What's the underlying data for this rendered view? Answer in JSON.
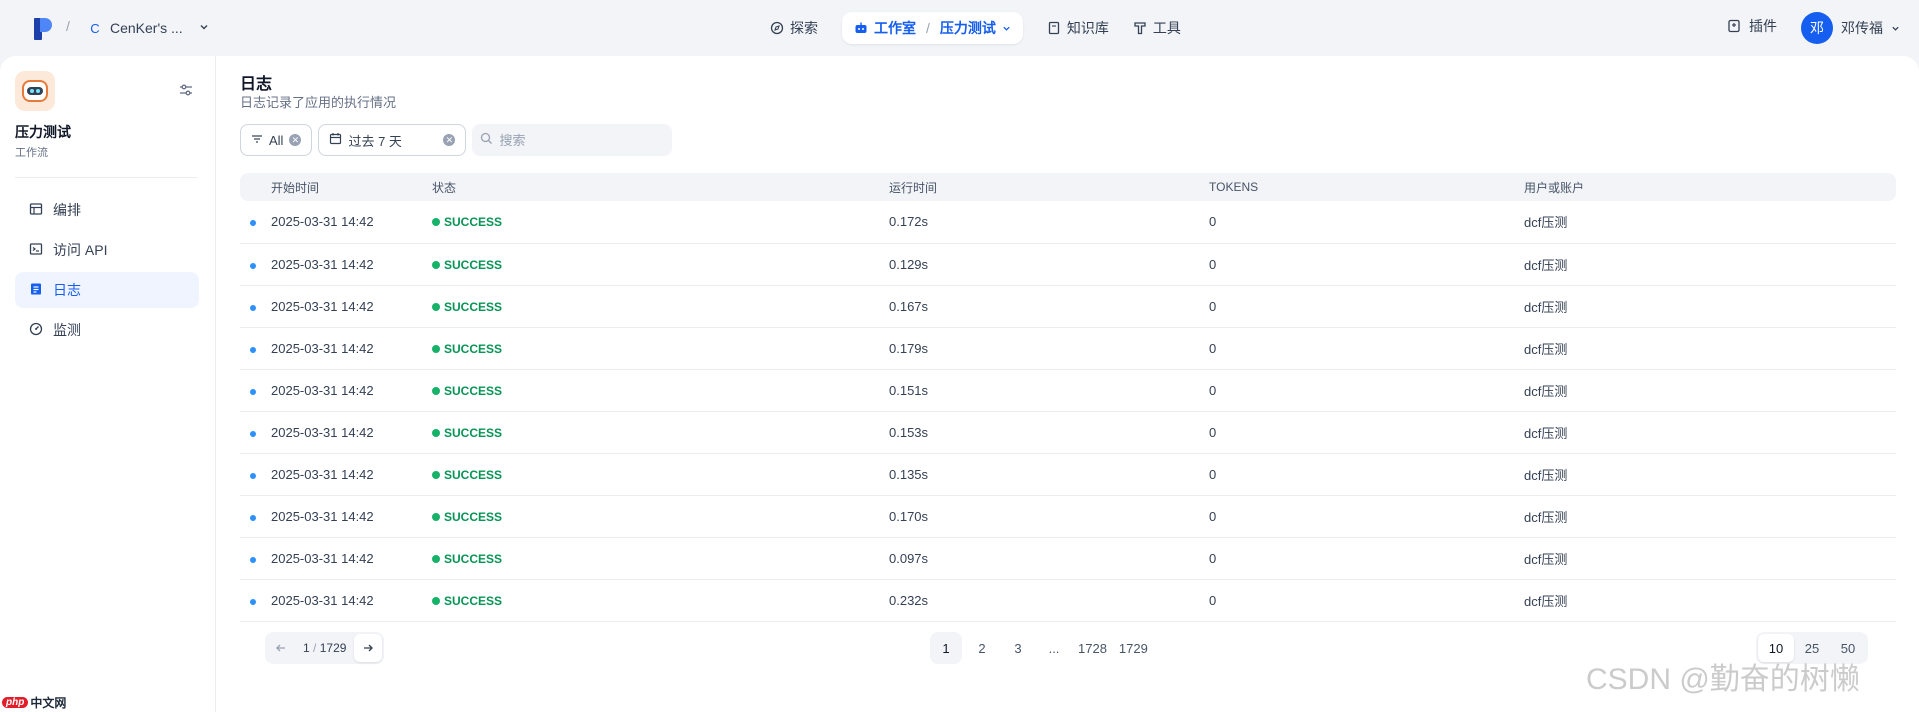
{
  "topbar": {
    "workspace_letter": "C",
    "workspace_name": "CenKer's ...",
    "nav": {
      "explore": "探索",
      "studio": "工作室",
      "studio_sub": "压力测试",
      "knowledge": "知识库",
      "tools": "工具"
    },
    "plugins": "插件",
    "user_initial": "邓",
    "user_name": "邓传福"
  },
  "sidebar": {
    "app_name": "压力测试",
    "app_type": "工作流",
    "items": [
      {
        "label": "编排",
        "icon": "layout-icon"
      },
      {
        "label": "访问 API",
        "icon": "terminal-icon"
      },
      {
        "label": "日志",
        "icon": "file-text-icon",
        "active": true
      },
      {
        "label": "监测",
        "icon": "gauge-icon"
      }
    ]
  },
  "logs": {
    "title": "日志",
    "description": "日志记录了应用的执行情况",
    "filter_status": "All",
    "filter_period": "过去 7 天",
    "search_placeholder": "搜索",
    "columns": [
      "开始时间",
      "状态",
      "运行时间",
      "TOKENS",
      "用户或账户"
    ],
    "rows": [
      {
        "start": "2025-03-31 14:42",
        "status": "SUCCESS",
        "runtime": "0.172s",
        "tokens": "0",
        "user": "dcf压测"
      },
      {
        "start": "2025-03-31 14:42",
        "status": "SUCCESS",
        "runtime": "0.129s",
        "tokens": "0",
        "user": "dcf压测"
      },
      {
        "start": "2025-03-31 14:42",
        "status": "SUCCESS",
        "runtime": "0.167s",
        "tokens": "0",
        "user": "dcf压测"
      },
      {
        "start": "2025-03-31 14:42",
        "status": "SUCCESS",
        "runtime": "0.179s",
        "tokens": "0",
        "user": "dcf压测"
      },
      {
        "start": "2025-03-31 14:42",
        "status": "SUCCESS",
        "runtime": "0.151s",
        "tokens": "0",
        "user": "dcf压测"
      },
      {
        "start": "2025-03-31 14:42",
        "status": "SUCCESS",
        "runtime": "0.153s",
        "tokens": "0",
        "user": "dcf压测"
      },
      {
        "start": "2025-03-31 14:42",
        "status": "SUCCESS",
        "runtime": "0.135s",
        "tokens": "0",
        "user": "dcf压测"
      },
      {
        "start": "2025-03-31 14:42",
        "status": "SUCCESS",
        "runtime": "0.170s",
        "tokens": "0",
        "user": "dcf压测"
      },
      {
        "start": "2025-03-31 14:42",
        "status": "SUCCESS",
        "runtime": "0.097s",
        "tokens": "0",
        "user": "dcf压测"
      },
      {
        "start": "2025-03-31 14:42",
        "status": "SUCCESS",
        "runtime": "0.232s",
        "tokens": "0",
        "user": "dcf压测"
      }
    ]
  },
  "pagination": {
    "current": "1",
    "slash": "/",
    "total": "1729",
    "pages": [
      "1",
      "2",
      "3",
      "...",
      "1728",
      "1729"
    ],
    "page_sizes": [
      "10",
      "25",
      "50"
    ]
  },
  "watermarks": {
    "left_badge": "php",
    "left_text": "中文网",
    "right": "CSDN @勤奋的树懒"
  },
  "colors": {
    "accent": "#155eef",
    "success": "#17b26a",
    "background": "#f2f4f7"
  }
}
